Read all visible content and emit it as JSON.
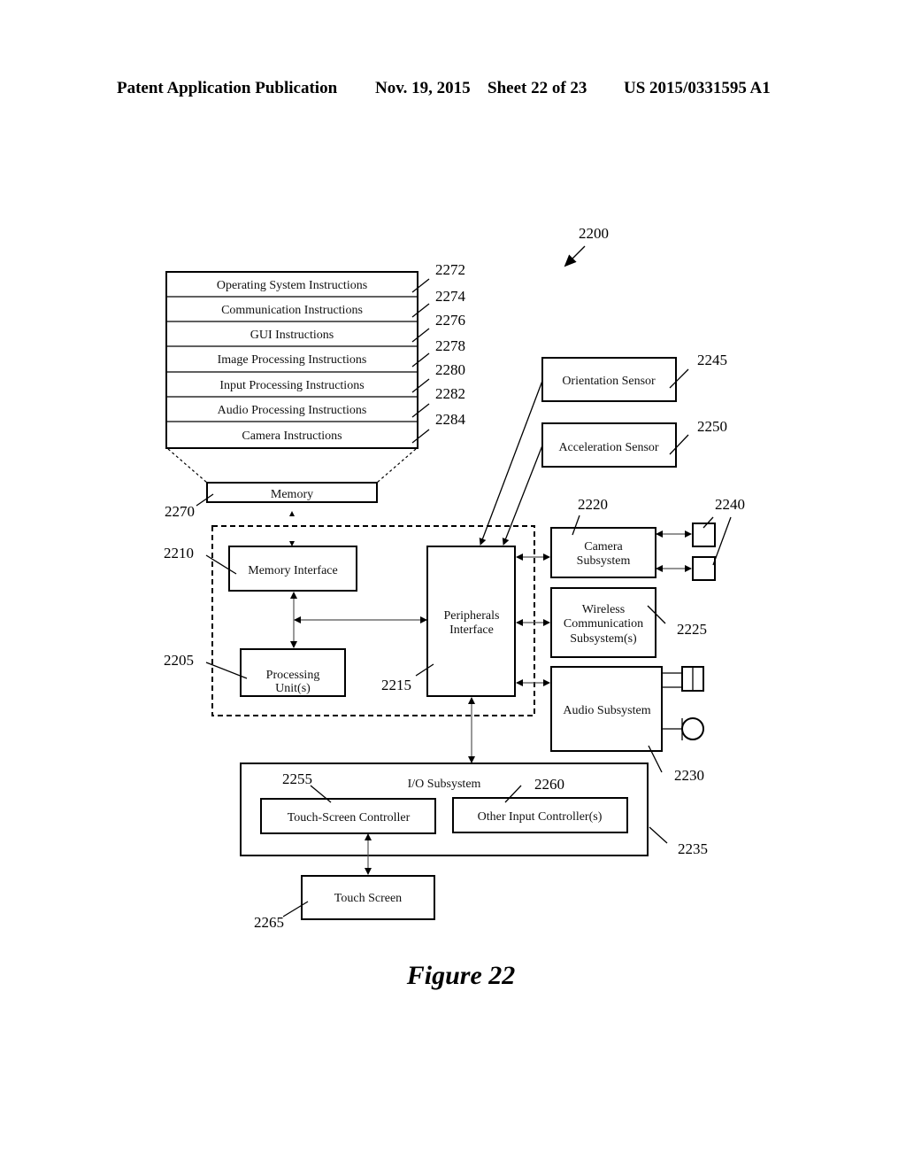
{
  "header": {
    "publication": "Patent Application Publication",
    "date": "Nov. 19, 2015",
    "sheet": "Sheet 22 of 23",
    "number": "US 2015/0331595 A1"
  },
  "figure": {
    "ref": "2200",
    "caption": "Figure 22"
  },
  "memory_stack": {
    "items": [
      {
        "label": "Operating System Instructions",
        "ref": "2272"
      },
      {
        "label": "Communication Instructions",
        "ref": "2274"
      },
      {
        "label": "GUI Instructions",
        "ref": "2276"
      },
      {
        "label": "Image Processing Instructions",
        "ref": "2278"
      },
      {
        "label": "Input Processing Instructions",
        "ref": "2280"
      },
      {
        "label": "Audio Processing Instructions",
        "ref": "2282"
      },
      {
        "label": "Camera Instructions",
        "ref": "2284"
      }
    ]
  },
  "blocks": {
    "memory": {
      "label": "Memory",
      "ref": "2270"
    },
    "memory_interface": {
      "label": "Memory Interface",
      "ref": "2210"
    },
    "processing_unit": {
      "line1": "Processing",
      "line2": "Unit(s)",
      "ref": "2205"
    },
    "peripherals_interface": {
      "line1": "Peripherals",
      "line2": "Interface",
      "ref": "2215"
    },
    "orientation_sensor": {
      "label": "Orientation Sensor",
      "ref": "2245"
    },
    "acceleration_sensor": {
      "label": "Acceleration Sensor",
      "ref": "2250"
    },
    "camera_subsystem": {
      "line1": "Camera",
      "line2": "Subsystem",
      "ref": "2220"
    },
    "optical_sensors": {
      "ref": "2240"
    },
    "wireless_subsystem": {
      "line1": "Wireless",
      "line2": "Communication",
      "line3": "Subsystem(s)",
      "ref": "2225"
    },
    "audio_subsystem": {
      "label": "Audio Subsystem",
      "ref": "2230"
    },
    "io_subsystem": {
      "label": "I/O Subsystem",
      "ref": "2235"
    },
    "touch_screen_controller": {
      "label": "Touch-Screen Controller",
      "ref": "2255"
    },
    "other_input_controllers": {
      "label": "Other Input Controller(s)",
      "ref": "2260"
    },
    "touch_screen": {
      "label": "Touch Screen",
      "ref": "2265"
    }
  }
}
